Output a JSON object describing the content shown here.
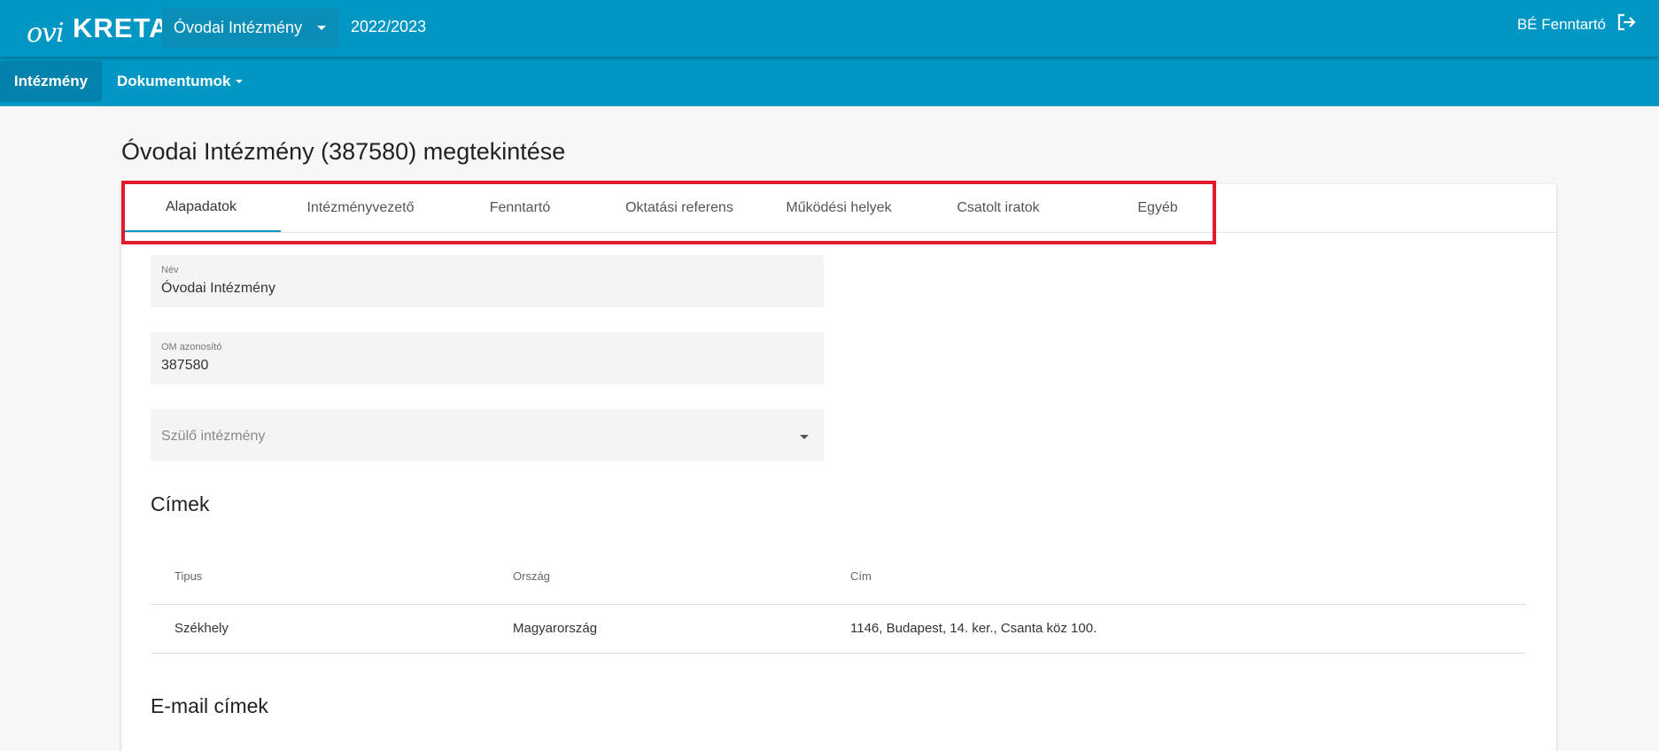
{
  "header": {
    "logo_text_left": "ovi",
    "logo_text_right": "KRETA",
    "institution_select": "Óvodai Intézmény",
    "school_year": "2022/2023",
    "user_name": "BÉ Fenntartó",
    "logout_icon": "logout-icon",
    "accent_color": "#0097c4"
  },
  "nav": {
    "items": [
      {
        "label": "Intézmény",
        "active": true
      },
      {
        "label": "Dokumentumok",
        "active": false
      }
    ]
  },
  "main": {
    "title": "Óvodai Intézmény (387580) megtekintése",
    "tabs": [
      {
        "label": "Alapadatok",
        "active": true
      },
      {
        "label": "Intézményvezető"
      },
      {
        "label": "Fenntartó"
      },
      {
        "label": "Oktatási referens"
      },
      {
        "label": "Működési helyek"
      },
      {
        "label": "Csatolt iratok"
      },
      {
        "label": "Egyéb"
      }
    ],
    "fields": {
      "name": {
        "label": "Név",
        "value": "Óvodai Intézmény"
      },
      "om": {
        "label": "OM azonosító",
        "value": "387580"
      },
      "parent": {
        "placeholder": "Szülő intézmény"
      }
    },
    "addresses": {
      "title": "Címek",
      "columns": [
        "Tipus",
        "Ország",
        "Cím"
      ],
      "rows": [
        [
          "Székhely",
          "Magyarország",
          "1146, Budapest, 14. ker., Csanta köz 100."
        ]
      ]
    },
    "emails": {
      "title": "E-mail címek"
    }
  }
}
